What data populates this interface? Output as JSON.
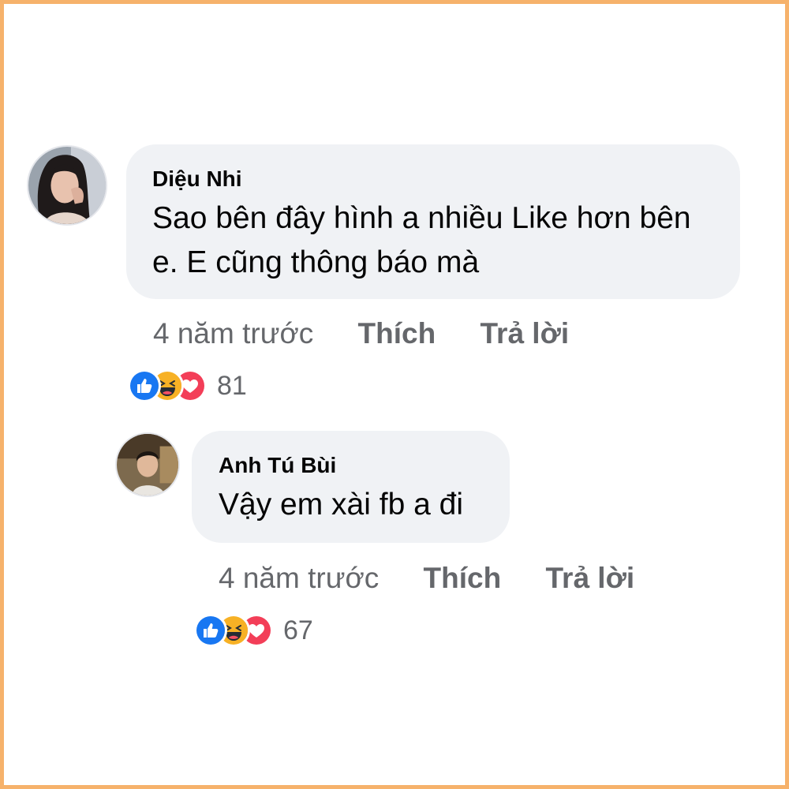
{
  "colors": {
    "frame_border": "#f6b26b",
    "bubble_bg": "#f0f2f5",
    "meta_text": "#65676b",
    "like_blue": "#1877f2",
    "haha_yellow": "#f7b125",
    "love_red": "#f33e58"
  },
  "comments": [
    {
      "author": "Diệu Nhi",
      "text_line1": "Sao bên đây hình a nhiều Like hơn bên",
      "text_line2": "e. E cũng thông báo mà",
      "time": "4 năm trước",
      "like_label": "Thích",
      "reply_label": "Trả lời",
      "reactions": [
        "like-icon",
        "haha-icon",
        "love-icon"
      ],
      "reaction_count": "81"
    },
    {
      "author": "Anh Tú Bùi",
      "text_line1": "Vậy em xài fb a đi",
      "time": "4 năm trước",
      "like_label": "Thích",
      "reply_label": "Trả lời",
      "reactions": [
        "like-icon",
        "haha-icon",
        "love-icon"
      ],
      "reaction_count": "67"
    }
  ]
}
